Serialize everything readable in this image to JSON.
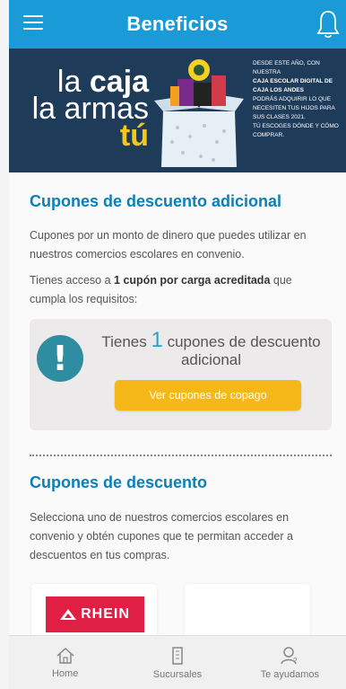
{
  "header": {
    "title": "Beneficios",
    "menu_icon": "hamburger-menu-icon",
    "bell_icon": "bell-icon"
  },
  "banner": {
    "line1a": "la ",
    "line1b": "caja",
    "line2": "la armas",
    "line3": "tú",
    "copy_1": "Desde este año, con nuestra",
    "copy_2": "Caja Escolar Digital de Caja Los Andes",
    "copy_3": "podrás adquirir lo que necesiten tus hijos para sus clases 2021.",
    "copy_4": "Tú escoges dónde y cómo comprar."
  },
  "additional_coupons": {
    "title": "Cupones de descuento adicional",
    "description": "Cupones por un monto de dinero que puedes utilizar en nuestros comercios escolares en convenio.",
    "access_prefix": "Tienes acceso a ",
    "access_bold": "1 cupón por carga acreditada",
    "access_suffix": " que cumpla los requisitos:",
    "card": {
      "prefix": "Tienes ",
      "count": "1",
      "suffix": "cupones de descuento adicional",
      "button_label": "Ver cupones de copago"
    }
  },
  "discount_coupons": {
    "title": "Cupones de descuento",
    "description": "Selecciona uno de nuestros comercios escolares en convenio y obtén cupones que te permitan acceder a descuentos en tus compras.",
    "stores": [
      {
        "name": "RHEIN"
      }
    ]
  },
  "bottom_nav": {
    "items": [
      {
        "label": "Home",
        "icon": "home-icon"
      },
      {
        "label": "Sucursales",
        "icon": "building-icon"
      },
      {
        "label": "Te ayudamos",
        "icon": "help-person-icon"
      }
    ]
  },
  "colors": {
    "primary": "#1a9ad6",
    "title_blue": "#0a7fb8",
    "accent_yellow": "#f6b818",
    "alert_teal": "#2e8da0",
    "banner_navy": "#1e3c5a",
    "rhein_red": "#e01f45"
  }
}
